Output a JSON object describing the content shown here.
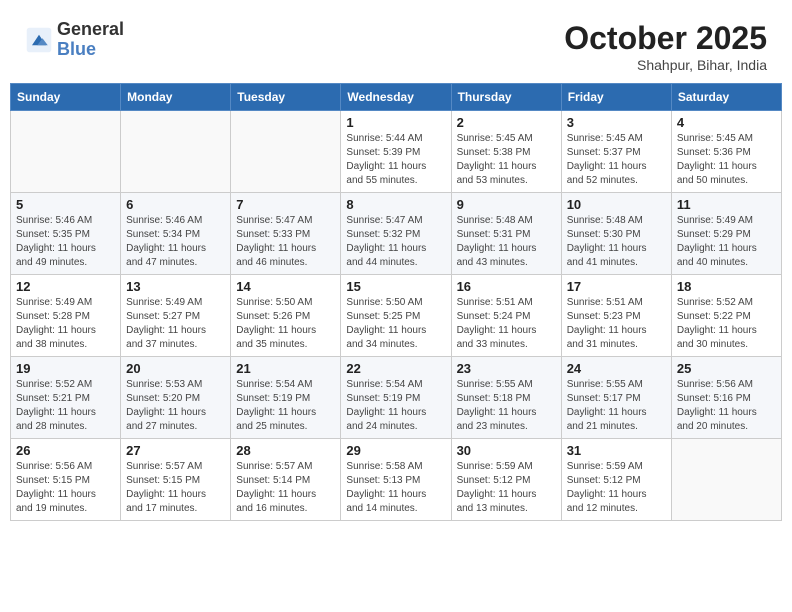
{
  "header": {
    "logo_general": "General",
    "logo_blue": "Blue",
    "month": "October 2025",
    "location": "Shahpur, Bihar, India"
  },
  "weekdays": [
    "Sunday",
    "Monday",
    "Tuesday",
    "Wednesday",
    "Thursday",
    "Friday",
    "Saturday"
  ],
  "weeks": [
    [
      {
        "day": "",
        "info": ""
      },
      {
        "day": "",
        "info": ""
      },
      {
        "day": "",
        "info": ""
      },
      {
        "day": "1",
        "info": "Sunrise: 5:44 AM\nSunset: 5:39 PM\nDaylight: 11 hours\nand 55 minutes."
      },
      {
        "day": "2",
        "info": "Sunrise: 5:45 AM\nSunset: 5:38 PM\nDaylight: 11 hours\nand 53 minutes."
      },
      {
        "day": "3",
        "info": "Sunrise: 5:45 AM\nSunset: 5:37 PM\nDaylight: 11 hours\nand 52 minutes."
      },
      {
        "day": "4",
        "info": "Sunrise: 5:45 AM\nSunset: 5:36 PM\nDaylight: 11 hours\nand 50 minutes."
      }
    ],
    [
      {
        "day": "5",
        "info": "Sunrise: 5:46 AM\nSunset: 5:35 PM\nDaylight: 11 hours\nand 49 minutes."
      },
      {
        "day": "6",
        "info": "Sunrise: 5:46 AM\nSunset: 5:34 PM\nDaylight: 11 hours\nand 47 minutes."
      },
      {
        "day": "7",
        "info": "Sunrise: 5:47 AM\nSunset: 5:33 PM\nDaylight: 11 hours\nand 46 minutes."
      },
      {
        "day": "8",
        "info": "Sunrise: 5:47 AM\nSunset: 5:32 PM\nDaylight: 11 hours\nand 44 minutes."
      },
      {
        "day": "9",
        "info": "Sunrise: 5:48 AM\nSunset: 5:31 PM\nDaylight: 11 hours\nand 43 minutes."
      },
      {
        "day": "10",
        "info": "Sunrise: 5:48 AM\nSunset: 5:30 PM\nDaylight: 11 hours\nand 41 minutes."
      },
      {
        "day": "11",
        "info": "Sunrise: 5:49 AM\nSunset: 5:29 PM\nDaylight: 11 hours\nand 40 minutes."
      }
    ],
    [
      {
        "day": "12",
        "info": "Sunrise: 5:49 AM\nSunset: 5:28 PM\nDaylight: 11 hours\nand 38 minutes."
      },
      {
        "day": "13",
        "info": "Sunrise: 5:49 AM\nSunset: 5:27 PM\nDaylight: 11 hours\nand 37 minutes."
      },
      {
        "day": "14",
        "info": "Sunrise: 5:50 AM\nSunset: 5:26 PM\nDaylight: 11 hours\nand 35 minutes."
      },
      {
        "day": "15",
        "info": "Sunrise: 5:50 AM\nSunset: 5:25 PM\nDaylight: 11 hours\nand 34 minutes."
      },
      {
        "day": "16",
        "info": "Sunrise: 5:51 AM\nSunset: 5:24 PM\nDaylight: 11 hours\nand 33 minutes."
      },
      {
        "day": "17",
        "info": "Sunrise: 5:51 AM\nSunset: 5:23 PM\nDaylight: 11 hours\nand 31 minutes."
      },
      {
        "day": "18",
        "info": "Sunrise: 5:52 AM\nSunset: 5:22 PM\nDaylight: 11 hours\nand 30 minutes."
      }
    ],
    [
      {
        "day": "19",
        "info": "Sunrise: 5:52 AM\nSunset: 5:21 PM\nDaylight: 11 hours\nand 28 minutes."
      },
      {
        "day": "20",
        "info": "Sunrise: 5:53 AM\nSunset: 5:20 PM\nDaylight: 11 hours\nand 27 minutes."
      },
      {
        "day": "21",
        "info": "Sunrise: 5:54 AM\nSunset: 5:19 PM\nDaylight: 11 hours\nand 25 minutes."
      },
      {
        "day": "22",
        "info": "Sunrise: 5:54 AM\nSunset: 5:19 PM\nDaylight: 11 hours\nand 24 minutes."
      },
      {
        "day": "23",
        "info": "Sunrise: 5:55 AM\nSunset: 5:18 PM\nDaylight: 11 hours\nand 23 minutes."
      },
      {
        "day": "24",
        "info": "Sunrise: 5:55 AM\nSunset: 5:17 PM\nDaylight: 11 hours\nand 21 minutes."
      },
      {
        "day": "25",
        "info": "Sunrise: 5:56 AM\nSunset: 5:16 PM\nDaylight: 11 hours\nand 20 minutes."
      }
    ],
    [
      {
        "day": "26",
        "info": "Sunrise: 5:56 AM\nSunset: 5:15 PM\nDaylight: 11 hours\nand 19 minutes."
      },
      {
        "day": "27",
        "info": "Sunrise: 5:57 AM\nSunset: 5:15 PM\nDaylight: 11 hours\nand 17 minutes."
      },
      {
        "day": "28",
        "info": "Sunrise: 5:57 AM\nSunset: 5:14 PM\nDaylight: 11 hours\nand 16 minutes."
      },
      {
        "day": "29",
        "info": "Sunrise: 5:58 AM\nSunset: 5:13 PM\nDaylight: 11 hours\nand 14 minutes."
      },
      {
        "day": "30",
        "info": "Sunrise: 5:59 AM\nSunset: 5:12 PM\nDaylight: 11 hours\nand 13 minutes."
      },
      {
        "day": "31",
        "info": "Sunrise: 5:59 AM\nSunset: 5:12 PM\nDaylight: 11 hours\nand 12 minutes."
      },
      {
        "day": "",
        "info": ""
      }
    ]
  ]
}
